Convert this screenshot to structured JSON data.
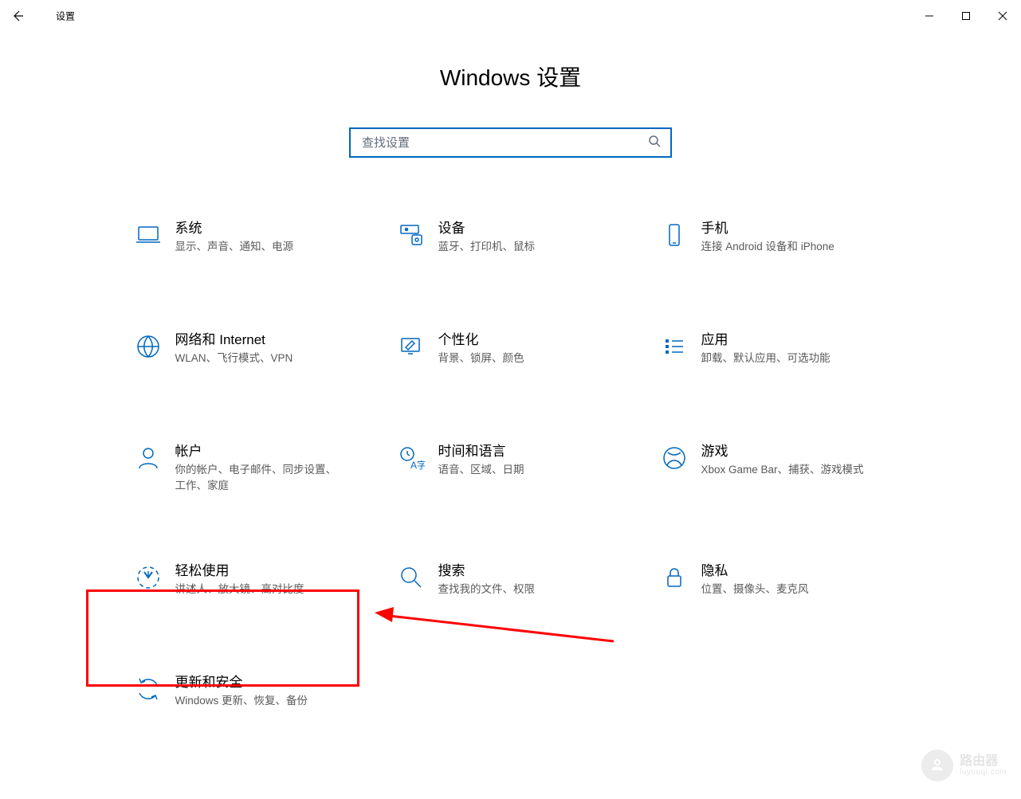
{
  "window": {
    "title": "设置"
  },
  "page": {
    "heading": "Windows 设置"
  },
  "search": {
    "placeholder": "查找设置"
  },
  "categories": [
    {
      "id": "system",
      "title": "系统",
      "desc": "显示、声音、通知、电源"
    },
    {
      "id": "devices",
      "title": "设备",
      "desc": "蓝牙、打印机、鼠标"
    },
    {
      "id": "phone",
      "title": "手机",
      "desc": "连接 Android 设备和 iPhone"
    },
    {
      "id": "network",
      "title": "网络和 Internet",
      "desc": "WLAN、飞行模式、VPN"
    },
    {
      "id": "personalize",
      "title": "个性化",
      "desc": "背景、锁屏、颜色"
    },
    {
      "id": "apps",
      "title": "应用",
      "desc": "卸载、默认应用、可选功能"
    },
    {
      "id": "accounts",
      "title": "帐户",
      "desc": "你的帐户、电子邮件、同步设置、工作、家庭"
    },
    {
      "id": "time",
      "title": "时间和语言",
      "desc": "语音、区域、日期"
    },
    {
      "id": "gaming",
      "title": "游戏",
      "desc": "Xbox Game Bar、捕获、游戏模式"
    },
    {
      "id": "ease",
      "title": "轻松使用",
      "desc": "讲述人、放大镜、高对比度"
    },
    {
      "id": "search",
      "title": "搜索",
      "desc": "查找我的文件、权限"
    },
    {
      "id": "privacy",
      "title": "隐私",
      "desc": "位置、摄像头、麦克风"
    },
    {
      "id": "update",
      "title": "更新和安全",
      "desc": "Windows 更新、恢复、备份"
    }
  ],
  "annotation": {
    "highlighted_category_id": "update"
  },
  "watermark": {
    "title": "路由器",
    "domain": "luyouqi.com"
  }
}
